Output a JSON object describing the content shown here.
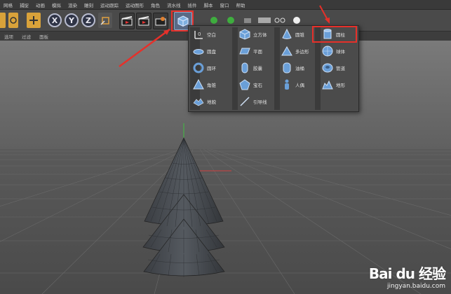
{
  "menu": {
    "items": [
      "网格",
      "捕捉",
      "动画",
      "模拟",
      "渲染",
      "雕刻",
      "运动跟踪",
      "运动图形",
      "角色",
      "流水线",
      "插件",
      "脚本",
      "窗口",
      "帮助"
    ]
  },
  "toolbar": {
    "axis_x": "X",
    "axis_y": "Y",
    "axis_z": "Z"
  },
  "subbar": {
    "items": [
      "选项",
      "过滤",
      "面板"
    ]
  },
  "dropdown": {
    "items": [
      {
        "label": "空白",
        "icon": "null-object-icon"
      },
      {
        "label": "圆盘",
        "icon": "disc-icon"
      },
      {
        "label": "圆环",
        "icon": "torus-icon"
      },
      {
        "label": "角锥",
        "icon": "pyramid-icon"
      },
      {
        "label": "地貌",
        "icon": "landscape-icon"
      },
      {
        "label": "立方体",
        "icon": "cube-icon"
      },
      {
        "label": "平面",
        "icon": "plane-icon"
      },
      {
        "label": "胶囊",
        "icon": "capsule-icon"
      },
      {
        "label": "宝石",
        "icon": "gem-icon"
      },
      {
        "label": "引导线",
        "icon": "guide-line-icon"
      },
      {
        "label": "圆锥",
        "icon": "cone-icon"
      },
      {
        "label": "多边形",
        "icon": "polygon-icon"
      },
      {
        "label": "油桶",
        "icon": "oil-tank-icon"
      },
      {
        "label": "人偶",
        "icon": "figure-icon"
      },
      {
        "label": "圆柱",
        "icon": "cylinder-icon"
      },
      {
        "label": "球体",
        "icon": "sphere-icon"
      },
      {
        "label": "管道",
        "icon": "tube-icon"
      },
      {
        "label": "地形",
        "icon": "relief-icon"
      }
    ]
  },
  "watermark": {
    "logo": "Bai du 经验",
    "url": "jingyan.baidu.com"
  },
  "colors": {
    "highlight_red": "#e6302a",
    "icon_blue": "#6a9fd8",
    "menu_bg": "#3a3a3a",
    "popup_bg": "#4b4b4b"
  }
}
